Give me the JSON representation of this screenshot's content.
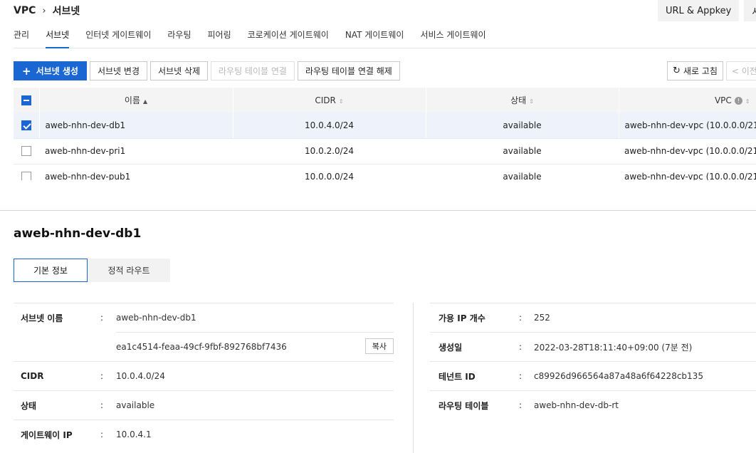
{
  "breadcrumb": {
    "root": "VPC",
    "current": "서브넷"
  },
  "top_buttons": {
    "appkey": "URL & Appkey",
    "usage": "사용"
  },
  "tabs": [
    "관리",
    "서브넷",
    "인터넷 게이트웨이",
    "라우팅",
    "피어링",
    "코로케이션 게이트웨이",
    "NAT 게이트웨이",
    "서비스 게이트웨이"
  ],
  "active_tab": 1,
  "toolbar": {
    "create": "서브넷 생성",
    "change": "서브넷 변경",
    "delete": "서브넷 삭제",
    "connect_route": "라우팅 테이블 연결",
    "disconnect_route": "라우팅 테이블 연결 해제",
    "refresh": "새로 고침",
    "prev": "< 이전"
  },
  "table": {
    "headers": {
      "name": "이름",
      "cidr": "CIDR",
      "state": "상태",
      "vpc": "VPC"
    },
    "rows": [
      {
        "name": "aweb-nhn-dev-db1",
        "cidr": "10.0.4.0/24",
        "state": "available",
        "vpc": "aweb-nhn-dev-vpc (10.0.0.0/21)",
        "selected": true
      },
      {
        "name": "aweb-nhn-dev-pri1",
        "cidr": "10.0.2.0/24",
        "state": "available",
        "vpc": "aweb-nhn-dev-vpc (10.0.0.0/21)",
        "selected": false
      },
      {
        "name": "aweb-nhn-dev-pub1",
        "cidr": "10.0.0.0/24",
        "state": "available",
        "vpc": "aweb-nhn-dev-vpc (10.0.0.0/21)",
        "selected": false
      }
    ]
  },
  "detail": {
    "title": "aweb-nhn-dev-db1",
    "tabs": {
      "basic": "기본 정보",
      "static_route": "정적 라우트"
    },
    "left": {
      "subnet_name_label": "서브넷 이름",
      "subnet_name": "aweb-nhn-dev-db1",
      "subnet_id": "ea1c4514-feaa-49cf-9fbf-892768bf7436",
      "copy": "복사",
      "cidr_label": "CIDR",
      "cidr": "10.0.4.0/24",
      "state_label": "상태",
      "state": "available",
      "gateway_label": "게이트웨이 IP",
      "gateway": "10.0.4.1"
    },
    "right": {
      "avail_ip_label": "가용 IP 개수",
      "avail_ip": "252",
      "created_label": "생성일",
      "created": "2022-03-28T18:11:40+09:00 (7분 전)",
      "tenant_label": "테넌트 ID",
      "tenant": "c89926d966564a87a48a6f64228cb135",
      "route_table_label": "라우팅 테이블",
      "route_table": "aweb-nhn-dev-db-rt"
    },
    "colon": ":"
  },
  "colors": {
    "accent": "#1a66d2",
    "selected_row": "#eef3fb"
  }
}
